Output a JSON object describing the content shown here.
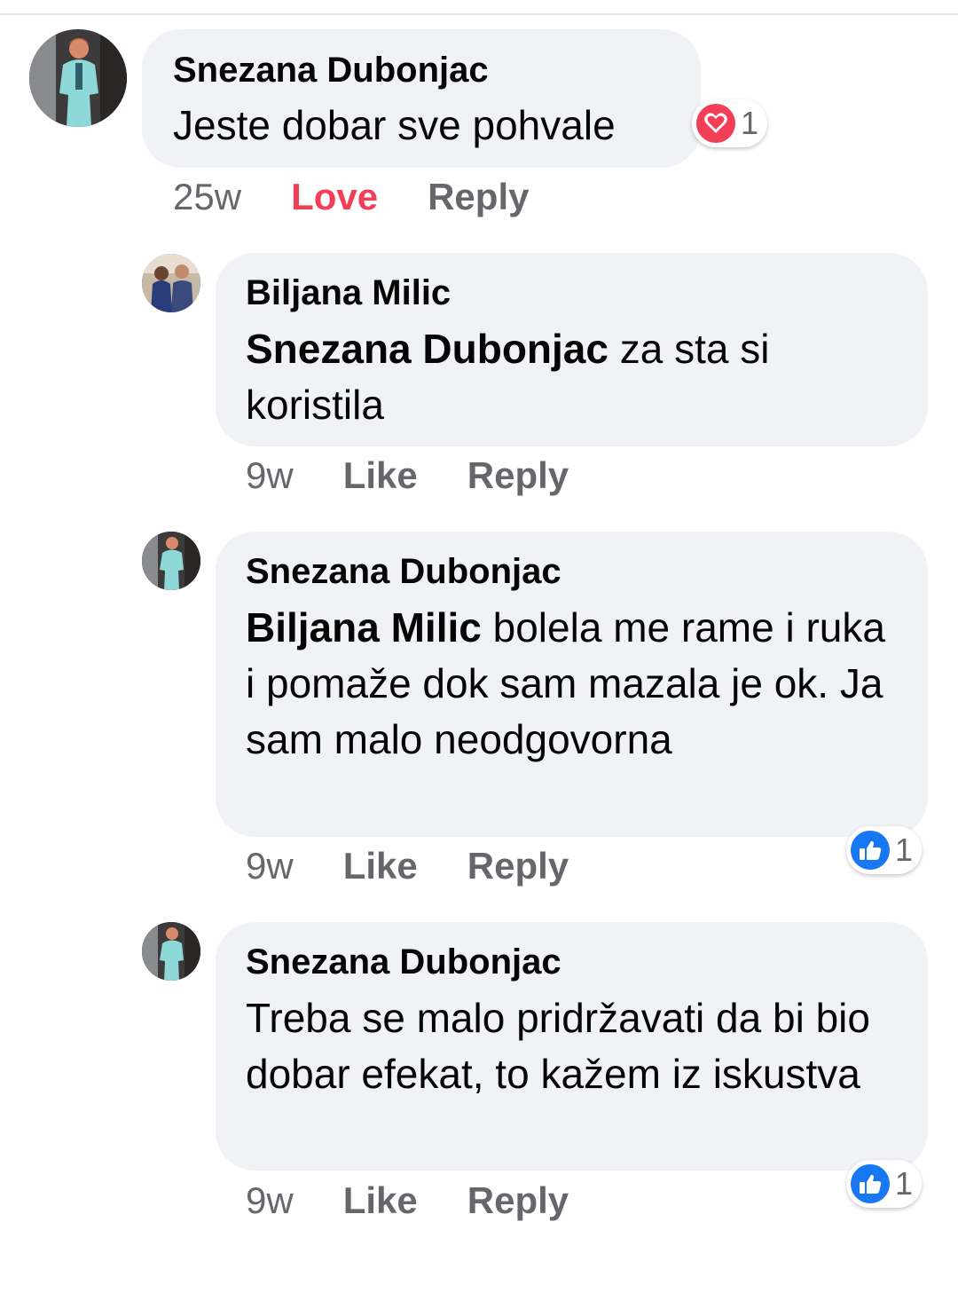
{
  "comments": [
    {
      "author": "Snezana Dubonjac",
      "mention": "",
      "text": "Jeste dobar sve pohvale",
      "time": "25w",
      "like_label": "Love",
      "reply_label": "Reply",
      "reaction": {
        "icon": "heart-icon",
        "count": "1",
        "color": "#f33e58"
      }
    },
    {
      "author": "Biljana Milic",
      "mention": "Snezana Dubonjac",
      "text": " za  sta si koristila",
      "time": "9w",
      "like_label": "Like",
      "reply_label": "Reply"
    },
    {
      "author": "Snezana Dubonjac",
      "mention": "Biljana Milic",
      "text": " bolela me rame i ruka i pomaže dok sam mazala je ok. Ja sam malo neodgovorna",
      "time": "9w",
      "like_label": "Like",
      "reply_label": "Reply",
      "reaction": {
        "icon": "thumbs-up-icon",
        "count": "1",
        "color": "#1877f2"
      }
    },
    {
      "author": "Snezana Dubonjac",
      "mention": "",
      "text": "Treba se malo pridržavati da bi bio dobar efekat, to kažem iz iskustva",
      "time": "9w",
      "like_label": "Like",
      "reply_label": "Reply",
      "reaction": {
        "icon": "thumbs-up-icon",
        "count": "1",
        "color": "#1877f2"
      }
    }
  ]
}
